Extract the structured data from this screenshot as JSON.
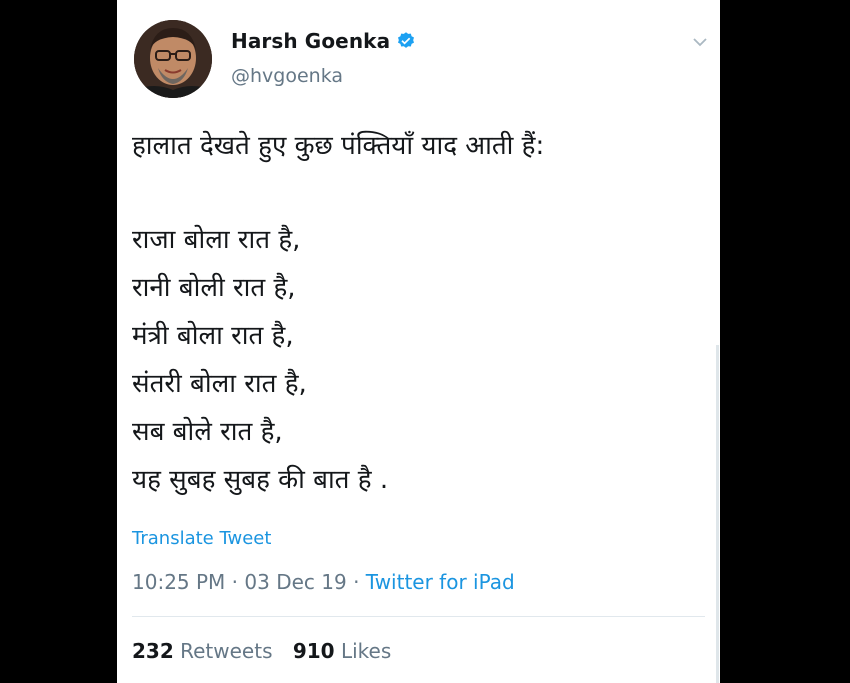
{
  "user": {
    "name": "Harsh Goenka",
    "handle": "@hvgoenka",
    "verified_icon": "verified-badge-icon",
    "avatar_icon": "profile-avatar"
  },
  "tweet": {
    "lines": [
      "हालात देखते हुए कुछ पंक्तियाँ याद आती हैं:",
      "",
      "राजा बोला रात है,",
      "रानी बोली रात है,",
      "मंत्री बोला रात है,",
      "संतरी बोला रात है,",
      "सब बोले रात है,",
      "यह सुबह सुबह की बात है ."
    ],
    "translate_label": "Translate Tweet",
    "time": "10:25 PM",
    "separator1": " · ",
    "date": "03 Dec 19",
    "separator2": " · ",
    "source": "Twitter for iPad"
  },
  "stats": {
    "retweets_count": "232",
    "retweets_label": "Retweets",
    "likes_count": "910",
    "likes_label": "Likes"
  },
  "colors": {
    "accent": "#1b95e0",
    "text": "#14171a",
    "muted": "#657786",
    "background": "#ffffff"
  }
}
